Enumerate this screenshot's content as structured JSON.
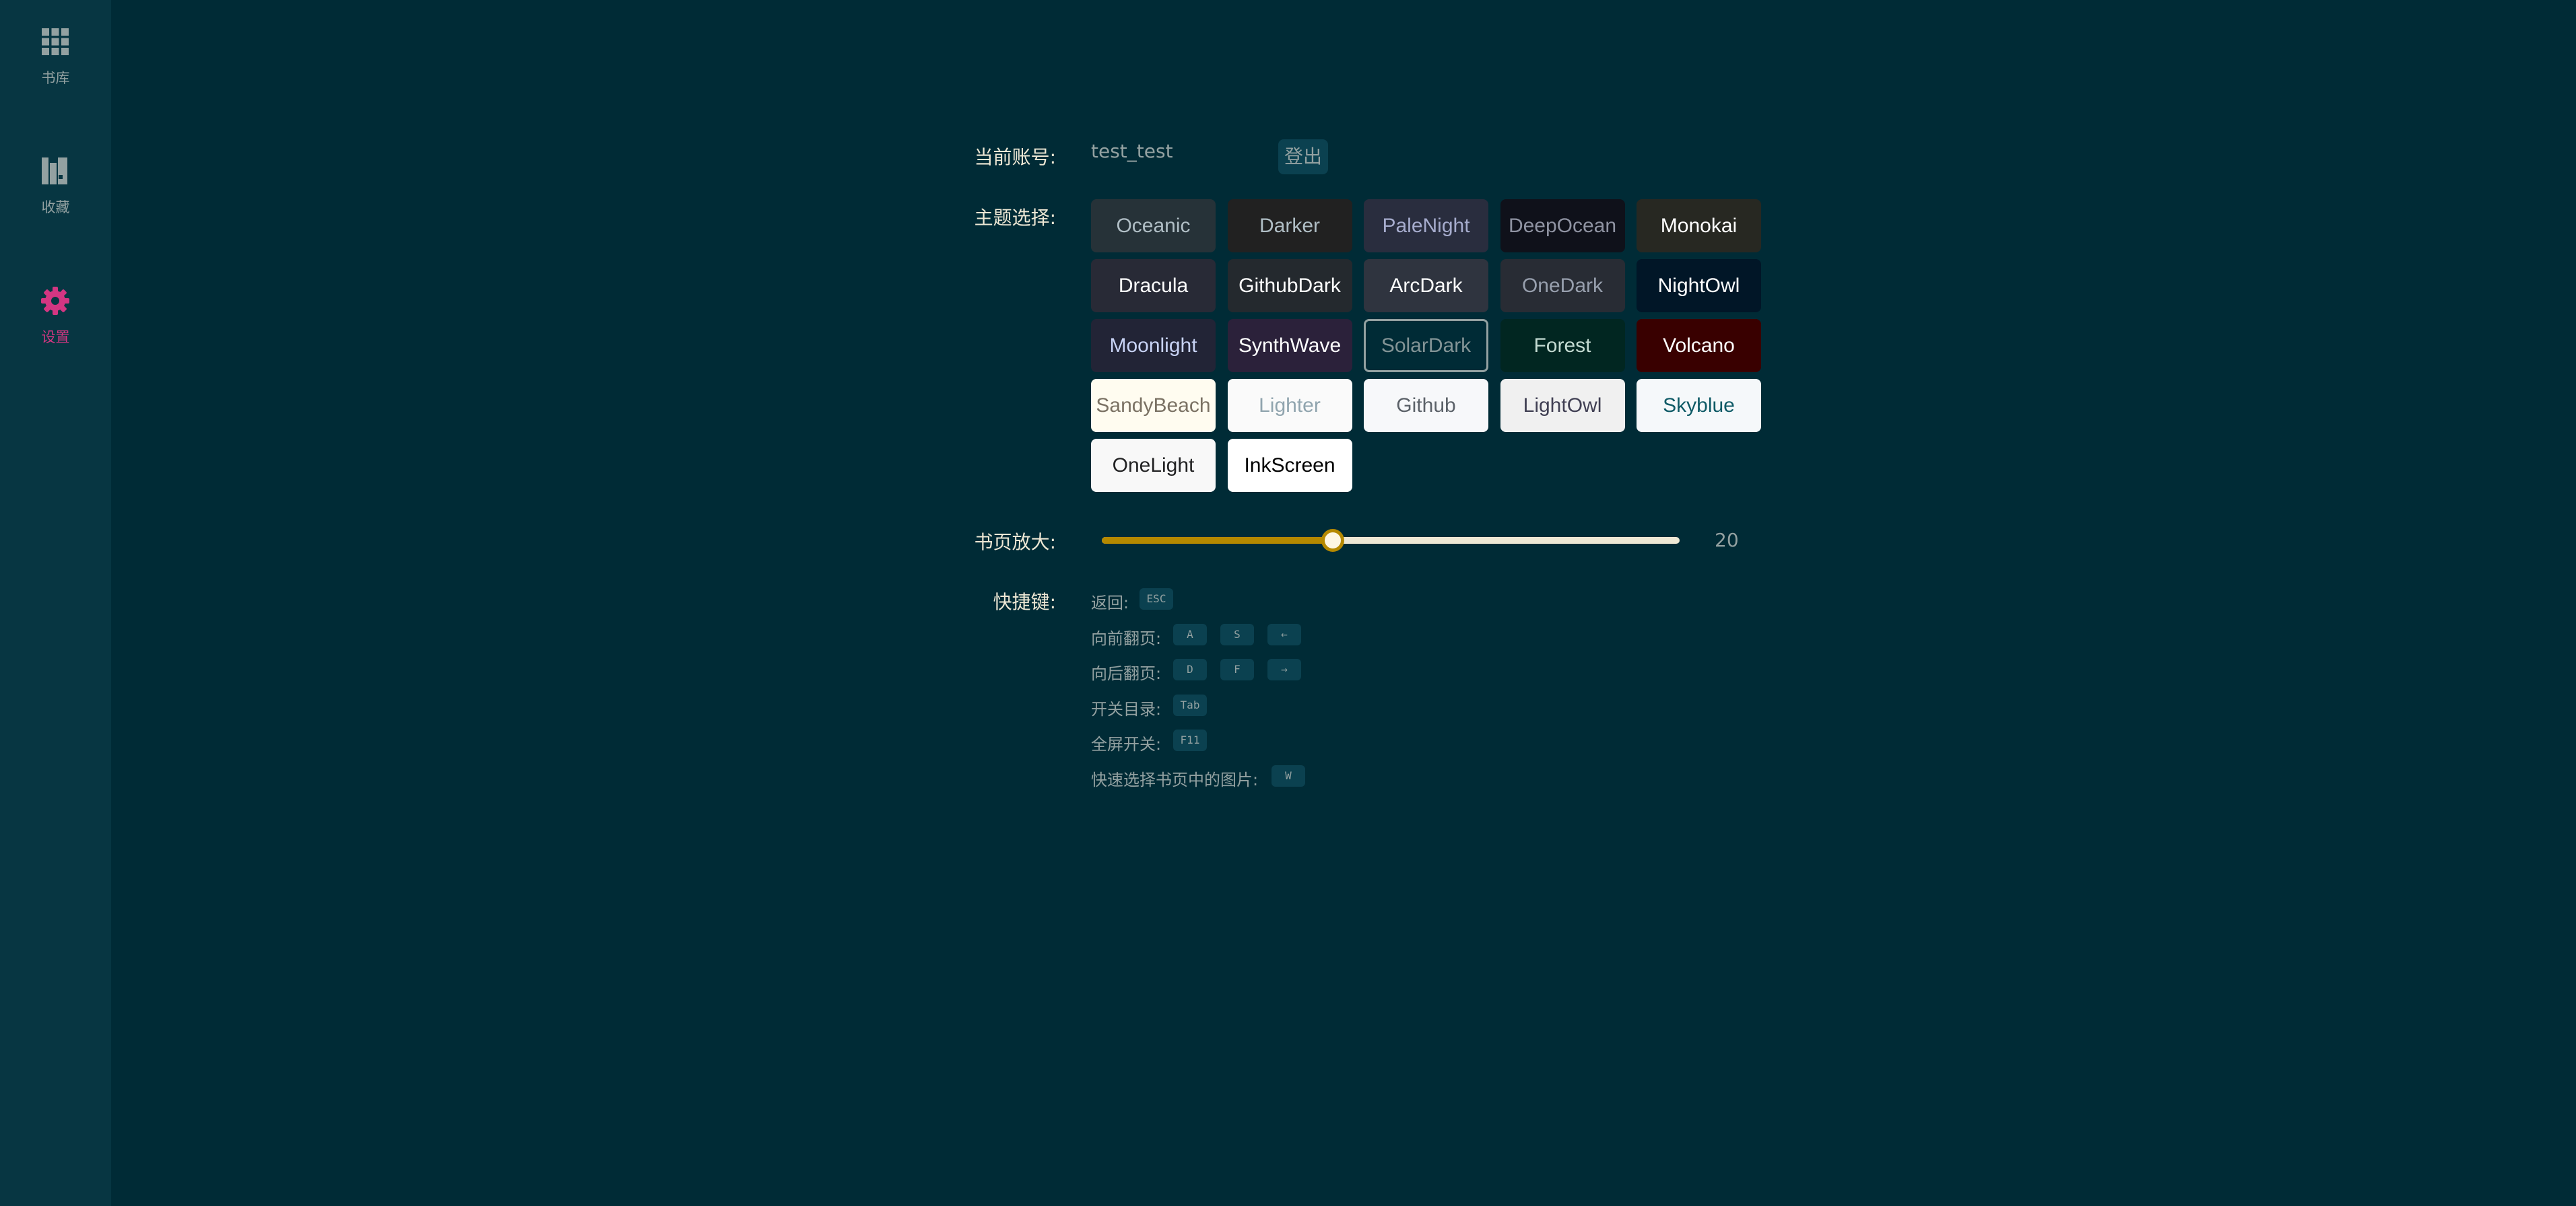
{
  "sidebar": {
    "items": [
      {
        "label": "书库",
        "icon": "grid-icon",
        "active": false
      },
      {
        "label": "收藏",
        "icon": "bookshelf-icon",
        "active": false
      },
      {
        "label": "设置",
        "icon": "gear-icon",
        "active": true
      }
    ]
  },
  "account": {
    "label": "当前账号:",
    "value": "test_test",
    "logout_label": "登出"
  },
  "theme": {
    "label": "主题选择:",
    "selected": "SolarDark",
    "options": [
      {
        "name": "Oceanic",
        "bg": "#263238",
        "fg": "#b0bec5"
      },
      {
        "name": "Darker",
        "bg": "#212121",
        "fg": "#b0bec5"
      },
      {
        "name": "PaleNight",
        "bg": "#292d3e",
        "fg": "#a6accd"
      },
      {
        "name": "DeepOcean",
        "bg": "#0f111a",
        "fg": "#8f93a2"
      },
      {
        "name": "Monokai",
        "bg": "#272822",
        "fg": "#ffffff"
      },
      {
        "name": "Dracula",
        "bg": "#282a36",
        "fg": "#ffffff"
      },
      {
        "name": "GithubDark",
        "bg": "#24292e",
        "fg": "#ffffff"
      },
      {
        "name": "ArcDark",
        "bg": "#2f343f",
        "fg": "#ffffff"
      },
      {
        "name": "OneDark",
        "bg": "#282c34",
        "fg": "#979fad"
      },
      {
        "name": "NightOwl",
        "bg": "#011627",
        "fg": "#ffffff"
      },
      {
        "name": "Moonlight",
        "bg": "#222436",
        "fg": "#c8d3f5"
      },
      {
        "name": "SynthWave",
        "bg": "#2b213a",
        "fg": "#ffffff"
      },
      {
        "name": "SolarDark",
        "bg": "#002b36",
        "fg": "#839496"
      },
      {
        "name": "Forest",
        "bg": "#012621",
        "fg": "#c4dbd2"
      },
      {
        "name": "Volcano",
        "bg": "#390000",
        "fg": "#ffffff"
      },
      {
        "name": "SandyBeach",
        "bg": "#fffcf0",
        "fg": "#7a7163"
      },
      {
        "name": "Lighter",
        "bg": "#fafafa",
        "fg": "#90a4ae"
      },
      {
        "name": "Github",
        "bg": "#f7f8fa",
        "fg": "#5b6168"
      },
      {
        "name": "LightOwl",
        "bg": "#f0f0f0",
        "fg": "#403f53"
      },
      {
        "name": "Skyblue",
        "bg": "#f5f8fa",
        "fg": "#0e5a66"
      },
      {
        "name": "OneLight",
        "bg": "#f8f8f8",
        "fg": "#232324"
      },
      {
        "name": "InkScreen",
        "bg": "#ffffff",
        "fg": "#000000"
      }
    ]
  },
  "zoom": {
    "label": "书页放大:",
    "value": "20",
    "fraction": 0.4
  },
  "shortcuts": {
    "label": "快捷键:",
    "items": [
      {
        "label": "返回:",
        "keys": [
          "ESC"
        ]
      },
      {
        "label": "向前翻页:",
        "keys": [
          "A",
          "S",
          "←"
        ]
      },
      {
        "label": "向后翻页:",
        "keys": [
          "D",
          "F",
          "→"
        ]
      },
      {
        "label": "开关目录:",
        "keys": [
          "Tab"
        ]
      },
      {
        "label": "全屏开关:",
        "keys": [
          "F11"
        ]
      },
      {
        "label": "快速选择书页中的图片:",
        "keys": [
          "W"
        ]
      }
    ]
  },
  "colors": {
    "background": "#002b36",
    "sidebar": "#073642",
    "accent": "#d33682",
    "slider_fill": "#b58900",
    "muted_text": "#93a1a1",
    "label_text": "#eee8d5"
  }
}
